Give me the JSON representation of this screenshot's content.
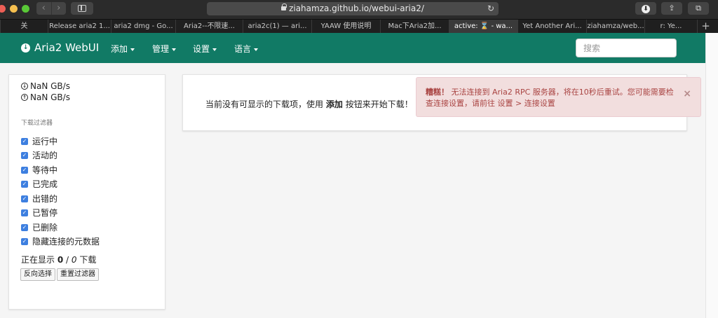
{
  "browser": {
    "back_glyph": "‹",
    "forward_glyph": "›",
    "url": "ziahamza.github.io/webui-aria2/",
    "reload_glyph": "↻",
    "download_glyph": "⬇",
    "share_glyph": "⇪",
    "tabs_glyph": "⧉",
    "tabs": [
      {
        "label": "关",
        "active": false
      },
      {
        "label": "Release aria2 1...",
        "active": false
      },
      {
        "label": "aria2 dmg - Go...",
        "active": false
      },
      {
        "label": "Aria2--不限速...",
        "active": false
      },
      {
        "label": "aria2c(1) — ari...",
        "active": false
      },
      {
        "label": "YAAW 使用说明",
        "active": false
      },
      {
        "label": "Mac下Aria2加...",
        "active": false
      },
      {
        "label": "active: ⌛ - wa...",
        "active": true
      },
      {
        "label": "Yet Another Ari...",
        "active": false
      },
      {
        "label": "ziahamza/web...",
        "active": false
      },
      {
        "label": "r: Ye...",
        "active": false
      }
    ],
    "new_tab_glyph": "+"
  },
  "navbar": {
    "brand": "Aria2 WebUI",
    "brand_icon": "download-circle-icon",
    "menus": [
      "添加",
      "管理",
      "设置",
      "语言"
    ],
    "search_placeholder": "搜索",
    "accent_color": "#117a65"
  },
  "sidebar": {
    "download_speed": "NaN GB/s",
    "upload_speed": "NaN GB/s",
    "filter_title": "下载过滤器",
    "filters": [
      {
        "label": "运行中",
        "checked": true
      },
      {
        "label": "活动的",
        "checked": true
      },
      {
        "label": "等待中",
        "checked": true
      },
      {
        "label": "已完成",
        "checked": true
      },
      {
        "label": "出错的",
        "checked": true
      },
      {
        "label": "已暂停",
        "checked": true
      },
      {
        "label": "已删除",
        "checked": true
      },
      {
        "label": "隐藏连接的元数据",
        "checked": true
      }
    ],
    "status_prefix": "正在显示",
    "shown_count": "0",
    "separator": " / ",
    "total_count": "0",
    "status_suffix": "下载",
    "invert_button": "反向选择",
    "reset_button": "重置过滤器"
  },
  "main": {
    "empty_prefix": "当前没有可显示的下载项，使用",
    "empty_bold": "添加",
    "empty_suffix": "按钮来开始下载！"
  },
  "alert": {
    "title": "糟糕！",
    "message": "无法连接到 Aria2 RPC 服务器，将在10秒后重试。您可能需要检查连接设置，请前往 设置 > 连接设置",
    "close_glyph": "×",
    "bg_color": "#f2dede",
    "text_color": "#a94442"
  }
}
